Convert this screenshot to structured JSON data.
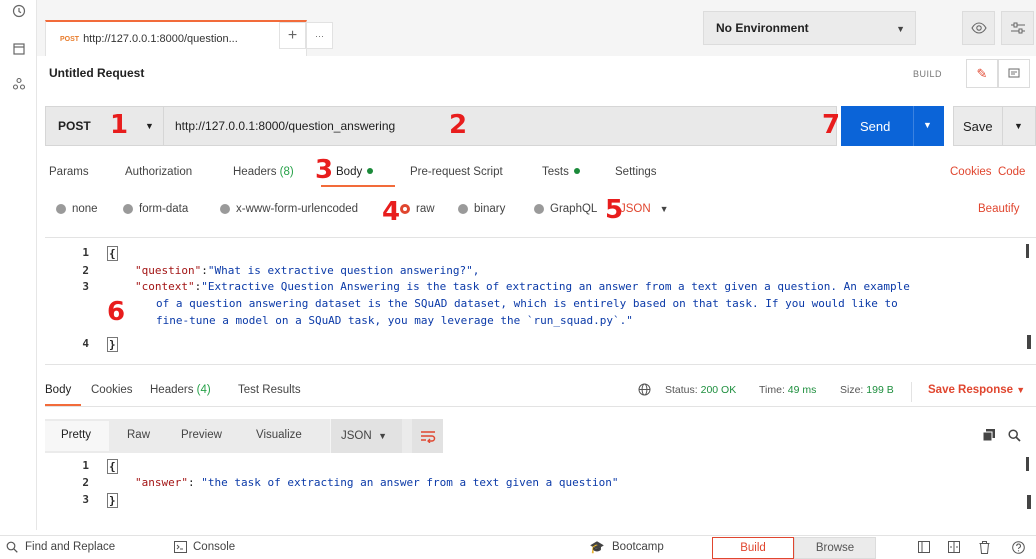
{
  "tab": {
    "method": "POST",
    "title": "http://127.0.0.1:8000/question...",
    "new_tab_glyph": "+",
    "more_glyph": "···"
  },
  "environment": {
    "selected": "No Environment"
  },
  "request": {
    "title": "Untitled Request",
    "mode_label": "BUILD",
    "method": "POST",
    "url": "http://127.0.0.1:8000/question_answering",
    "send_label": "Send",
    "save_label": "Save"
  },
  "request_tabs": [
    {
      "label": "Params"
    },
    {
      "label": "Authorization"
    },
    {
      "label": "Headers",
      "count": "(8)"
    },
    {
      "label": "Body"
    },
    {
      "label": "Pre-request Script"
    },
    {
      "label": "Tests"
    },
    {
      "label": "Settings"
    }
  ],
  "request_links": {
    "cookies": "Cookies",
    "code": "Code"
  },
  "body_options": [
    "none",
    "form-data",
    "x-www-form-urlencoded",
    "raw",
    "binary",
    "GraphQL"
  ],
  "body_format": "JSON",
  "beautify_label": "Beautify",
  "request_body": {
    "line_numbers": [
      "1",
      "2",
      "3",
      "4"
    ],
    "open_brace": "{",
    "close_brace": "}",
    "question_key": "\"question\"",
    "question_value": "\"What is extractive question answering?\",",
    "context_key": "\"context\"",
    "context_value_1": "\"Extractive Question Answering is the task of extracting an answer from a text given a question. An example",
    "context_value_2": "of a question answering dataset is the SQuAD dataset, which is entirely based on that task. If you would like to",
    "context_value_3": "fine-tune a model on a SQuAD task, you may leverage the `run_squad.py`.\""
  },
  "response_tabs": [
    {
      "label": "Body"
    },
    {
      "label": "Cookies"
    },
    {
      "label": "Headers",
      "count": "(4)"
    },
    {
      "label": "Test Results"
    }
  ],
  "response_status": {
    "status_label": "Status:",
    "status_value": "200 OK",
    "time_label": "Time:",
    "time_value": "49 ms",
    "size_label": "Size:",
    "size_value": "199 B",
    "save_response": "Save Response"
  },
  "response_view": {
    "modes": [
      "Pretty",
      "Raw",
      "Preview",
      "Visualize"
    ],
    "selected": "Pretty",
    "format": "JSON"
  },
  "response_body": {
    "line_numbers": [
      "1",
      "2",
      "3"
    ],
    "open_brace": "{",
    "close_brace": "}",
    "answer_key": "\"answer\"",
    "answer_value": "\"the task of extracting an answer from a text given a question\""
  },
  "footer": {
    "find_replace": "Find and Replace",
    "console": "Console",
    "bootcamp": "Bootcamp",
    "build": "Build",
    "browse": "Browse"
  },
  "annotations": [
    "1",
    "2",
    "3",
    "4",
    "5",
    "6",
    "7"
  ],
  "colors": {
    "accent": "#f26b3a",
    "send": "#0b64d8",
    "link": "#e0462f",
    "ok": "#1e8f3e",
    "annotation": "#e81d1d"
  }
}
